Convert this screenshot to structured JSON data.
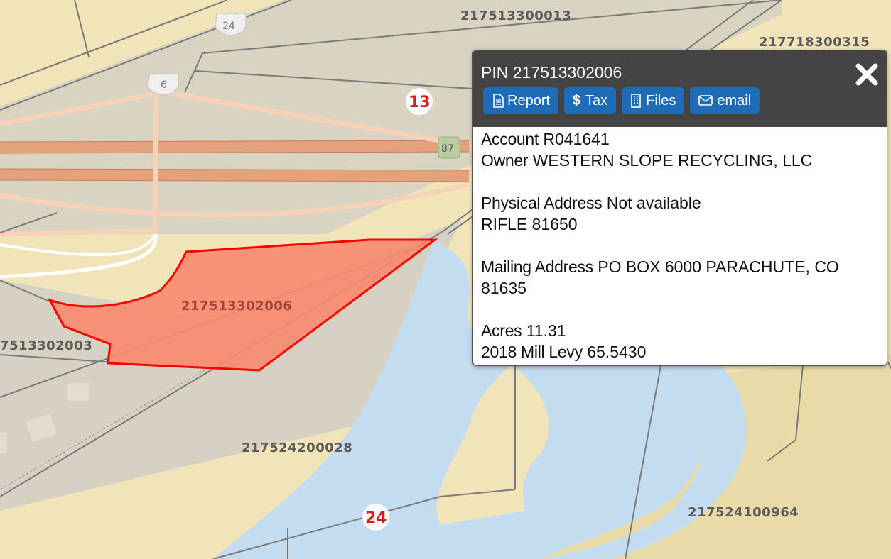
{
  "map": {
    "parcels": [
      "217513300013",
      "217718300315",
      "217513302006",
      "7513302003",
      "217524200028",
      "217524100964"
    ],
    "us_routes": [
      "24",
      "6"
    ],
    "highway": "87",
    "route_markers": [
      "13",
      "24"
    ],
    "colors": {
      "land": "#f0e4b8",
      "water": "#c4dcf0",
      "developed": "#d6d2c4",
      "highway": "#e09a70",
      "selected_fill": "#fa8a70",
      "selected_outline": "#ff0000"
    }
  },
  "popup": {
    "title": "PIN 217513302006",
    "close_icon": "close-x-icon",
    "buttons": [
      {
        "label": "Report",
        "icon": "document-icon"
      },
      {
        "label": "Tax",
        "icon": "dollar-icon"
      },
      {
        "label": "Files",
        "icon": "building-icon"
      },
      {
        "label": "email",
        "icon": "envelope-icon"
      }
    ],
    "account_label": "Account",
    "account": "R041641",
    "owner_label": "Owner",
    "owner": "WESTERN SLOPE RECYCLING, LLC",
    "physical_label": "Physical Address",
    "physical": "Not available",
    "physical_line2": "RIFLE 81650",
    "mailing_label": "Mailing Address",
    "mailing": "PO BOX 6000 PARACHUTE, CO",
    "mailing_line2": "81635",
    "acres_label": "Acres",
    "acres": "11.31",
    "levy_label": "2018 Mill Levy",
    "levy": "65.5430"
  }
}
